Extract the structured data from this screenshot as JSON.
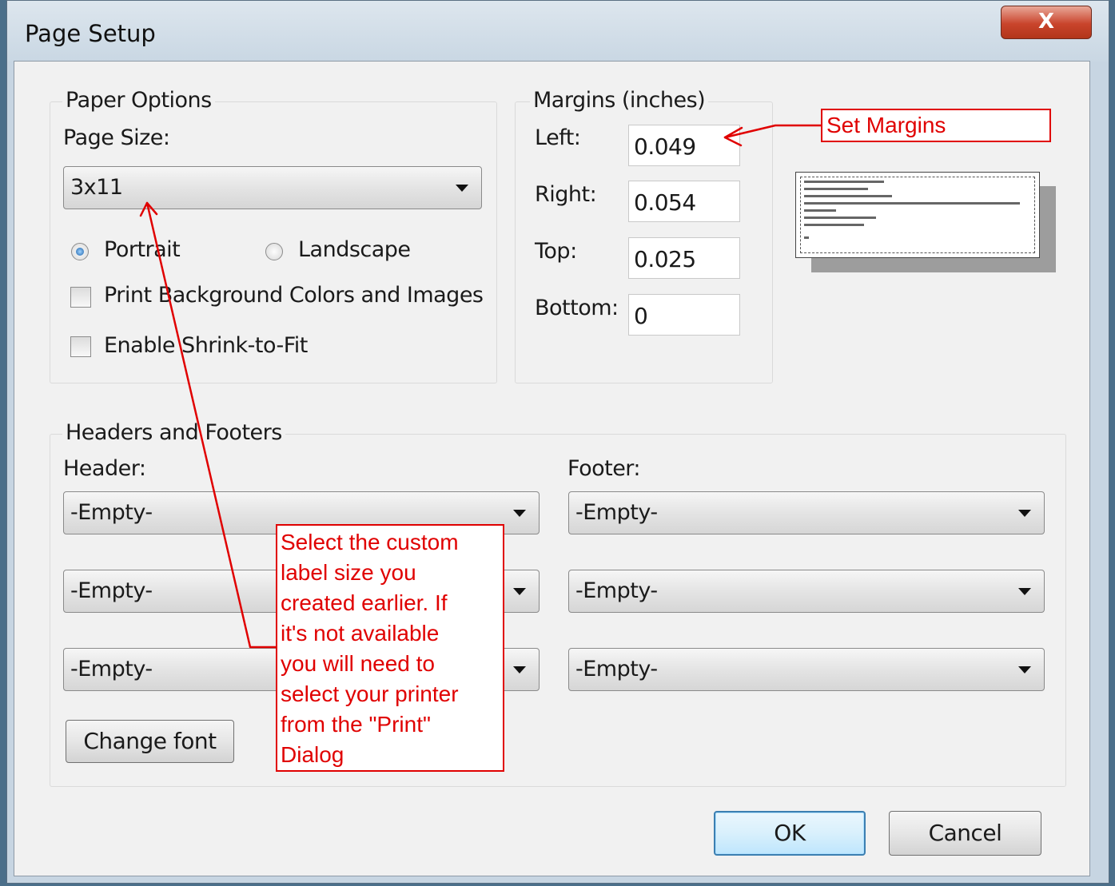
{
  "window": {
    "title": "Page Setup",
    "close_glyph": "X"
  },
  "paper_options": {
    "legend": "Paper Options",
    "page_size_label": "Page Size:",
    "page_size_value": "3x11",
    "portrait_label": "Portrait",
    "landscape_label": "Landscape",
    "orientation_selected": "Portrait",
    "print_bg_label": "Print Background Colors and Images",
    "print_bg_checked": false,
    "shrink_label": "Enable Shrink-to-Fit",
    "shrink_checked": false
  },
  "margins": {
    "legend": "Margins (inches)",
    "left_label": "Left:",
    "left_value": "0.049",
    "right_label": "Right:",
    "right_value": "0.054",
    "top_label": "Top:",
    "top_value": "0.025",
    "bottom_label": "Bottom:",
    "bottom_value": "0"
  },
  "headers_footers": {
    "legend": "Headers and Footers",
    "header_label": "Header:",
    "footer_label": "Footer:",
    "header_values": [
      "-Empty-",
      "-Empty-",
      "-Empty-"
    ],
    "footer_values": [
      "-Empty-",
      "-Empty-",
      "-Empty-"
    ],
    "change_font_label": "Change font"
  },
  "buttons": {
    "ok": "OK",
    "cancel": "Cancel"
  },
  "annotations": {
    "set_margins": "Set Margins",
    "label_size_lines": [
      "Select the custom",
      "label size you",
      "created earlier.  If",
      "it's not available",
      "you will need to",
      "select your printer",
      "from the \"Print\"",
      "Dialog"
    ],
    "color": "#e00000"
  }
}
